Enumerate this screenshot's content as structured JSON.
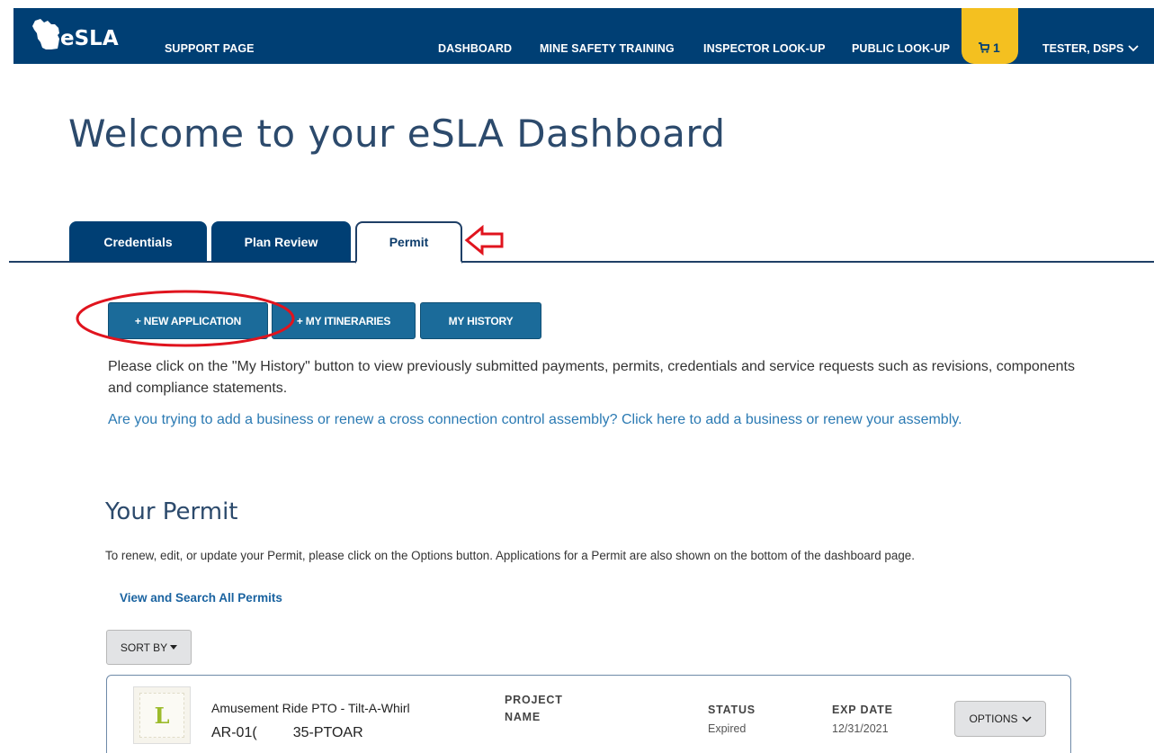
{
  "nav": {
    "logo_text": "eSLA",
    "support": "SUPPORT PAGE",
    "dashboard": "DASHBOARD",
    "mine_safety": "MINE SAFETY TRAINING",
    "inspector": "INSPECTOR LOOK-UP",
    "public": "PUBLIC LOOK-UP",
    "cart_count": "1",
    "user": "TESTER, DSPS",
    "bar_color": "#003f74",
    "cart_color": "#f4c020"
  },
  "page_title": "Welcome to your eSLA Dashboard",
  "tabs": [
    {
      "label": "Credentials",
      "active": false
    },
    {
      "label": "Plan Review",
      "active": false
    },
    {
      "label": "Permit",
      "active": true
    }
  ],
  "actions": {
    "new_application": "+ NEW APPLICATION",
    "my_itineraries": "+ MY ITINERARIES",
    "my_history": "MY HISTORY"
  },
  "info": {
    "history_text": "Please click on the \"My History\" button to view previously submitted payments, permits, credentials and service requests such as revisions, components and compliance statements.",
    "business_link": "Are you trying to add a business or renew a cross connection control assembly? Click here to add a business or renew your assembly."
  },
  "permit_section": {
    "heading": "Your Permit",
    "description": "To renew, edit, or update your Permit, please click on the Options button. Applications for a Permit are also shown on the bottom of the dashboard page.",
    "view_all": "View and Search All Permits",
    "sort_by": "SORT BY"
  },
  "permits": [
    {
      "thumb_letter": "L",
      "name": "Amusement Ride PTO - Tilt-A-Whirl",
      "id": "AR-01(         35-PTOAR",
      "project_name_label": "PROJECT NAME",
      "status_label": "STATUS",
      "status": "Expired",
      "exp_label": "EXP DATE",
      "exp_date": "12/31/2021",
      "options": "OPTIONS"
    }
  ],
  "icons": {
    "logo": "wisconsin-state-icon",
    "cart": "shopping-cart-icon",
    "user_menu": "chevron-down-icon",
    "sort": "caret-down-icon",
    "options": "chevron-down-icon",
    "annotation_arrow": "red-arrow-left-icon",
    "annotation_circle": "red-ellipse-annotation"
  }
}
